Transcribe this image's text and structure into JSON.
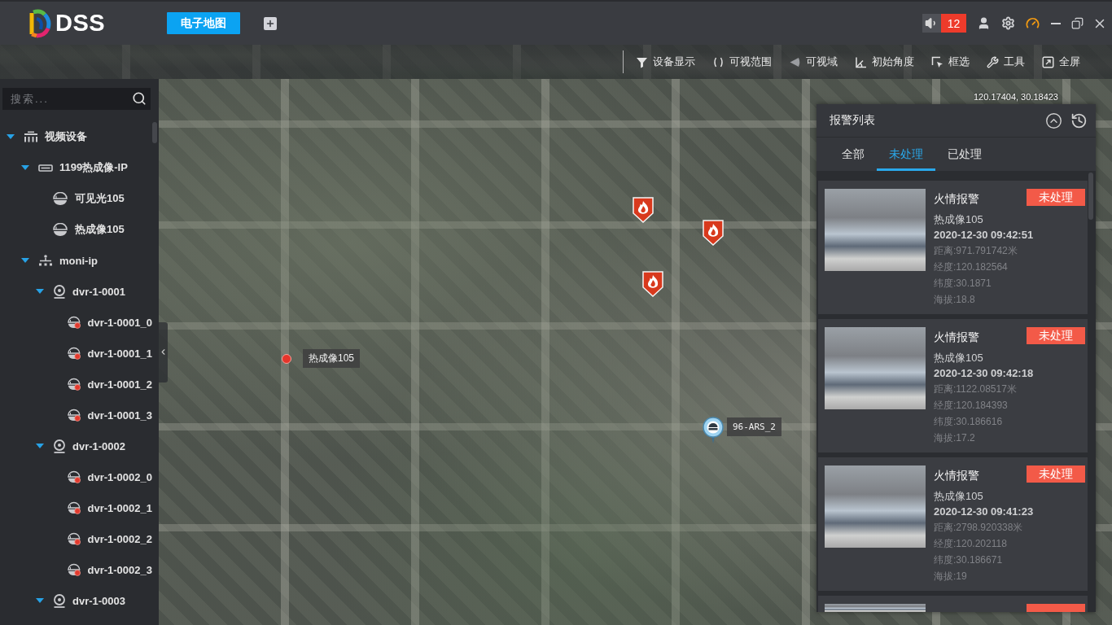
{
  "app": {
    "logo_text": "DSS",
    "tabs": [
      {
        "label": "电子地图",
        "selected": true
      }
    ],
    "alarm_count": "12"
  },
  "map_toolbar": {
    "items": [
      "设备显示",
      "可视范围",
      "可视域",
      "初始角度",
      "框选",
      "工具",
      "全屏"
    ]
  },
  "sidebar": {
    "search": {
      "placeholder": "搜索..."
    },
    "tree": [
      {
        "label": "视频设备",
        "kind": "group",
        "expanded": true,
        "children": [
          {
            "label": "1199热成像-IP",
            "kind": "nvr",
            "expanded": true,
            "children": [
              {
                "label": "可见光105",
                "kind": "camera",
                "offline": false
              },
              {
                "label": "热成像105",
                "kind": "camera",
                "offline": false
              }
            ]
          },
          {
            "label": "moni-ip",
            "kind": "network",
            "expanded": true,
            "children": [
              {
                "label": "dvr-1-0001",
                "kind": "encoder",
                "expanded": true,
                "children": [
                  {
                    "label": "dvr-1-0001_0",
                    "kind": "camera",
                    "offline": true
                  },
                  {
                    "label": "dvr-1-0001_1",
                    "kind": "camera",
                    "offline": true
                  },
                  {
                    "label": "dvr-1-0001_2",
                    "kind": "camera",
                    "offline": true
                  },
                  {
                    "label": "dvr-1-0001_3",
                    "kind": "camera",
                    "offline": true
                  }
                ]
              },
              {
                "label": "dvr-1-0002",
                "kind": "encoder",
                "expanded": true,
                "children": [
                  {
                    "label": "dvr-1-0002_0",
                    "kind": "camera",
                    "offline": true
                  },
                  {
                    "label": "dvr-1-0002_1",
                    "kind": "camera",
                    "offline": true
                  },
                  {
                    "label": "dvr-1-0002_2",
                    "kind": "camera",
                    "offline": true
                  },
                  {
                    "label": "dvr-1-0002_3",
                    "kind": "camera",
                    "offline": true
                  }
                ]
              },
              {
                "label": "dvr-1-0003",
                "kind": "encoder",
                "expanded": true
              }
            ]
          }
        ]
      }
    ]
  },
  "map": {
    "coordinates": "120.17404, 30.18423",
    "markers": [
      {
        "kind": "fire"
      },
      {
        "kind": "fire"
      },
      {
        "kind": "fire"
      },
      {
        "kind": "dot",
        "label": "热成像105"
      },
      {
        "kind": "camera",
        "label": "96-ARS_2"
      }
    ]
  },
  "alarm_panel": {
    "title": "报警列表",
    "tabs": [
      {
        "label": "全部",
        "selected": false
      },
      {
        "label": "未处理",
        "selected": true
      },
      {
        "label": "已处理",
        "selected": false
      }
    ],
    "alarms": [
      {
        "title": "火情报警",
        "status": "未处理",
        "device": "热成像105",
        "time": "2020-12-30 09:42:51",
        "distance": "距离:971.791742米",
        "longitude": "经度:120.182564",
        "latitude": "纬度:30.1871",
        "altitude": "海拔:18.8"
      },
      {
        "title": "火情报警",
        "status": "未处理",
        "device": "热成像105",
        "time": "2020-12-30 09:42:18",
        "distance": "距离:1122.08517米",
        "longitude": "经度:120.184393",
        "latitude": "纬度:30.186616",
        "altitude": "海拔:17.2"
      },
      {
        "title": "火情报警",
        "status": "未处理",
        "device": "热成像105",
        "time": "2020-12-30 09:41:23",
        "distance": "距离:2798.920338米",
        "longitude": "经度:120.202118",
        "latitude": "纬度:30.186671",
        "altitude": "海拔:19"
      }
    ]
  }
}
